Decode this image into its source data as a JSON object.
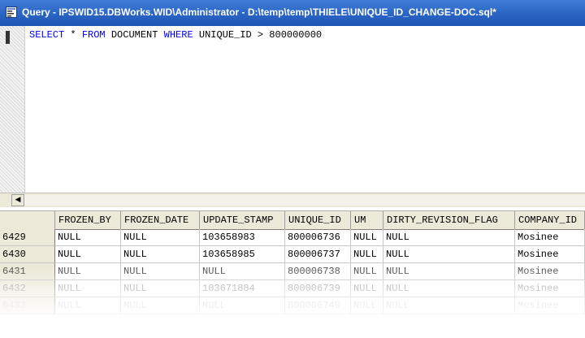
{
  "window": {
    "title": "Query - IPSWID15.DBWorks.WID\\Administrator - D:\\temp\\temp\\THIELE\\UNIQUE_ID_CHANGE-DOC.sql*"
  },
  "editor": {
    "sql_kw_select": "SELECT",
    "sql_star": " * ",
    "sql_kw_from": "FROM",
    "sql_table": " DOCUMENT ",
    "sql_kw_where": "WHERE",
    "sql_condition": " UNIQUE_ID > 800000000"
  },
  "grid": {
    "columns": [
      "FROZEN_BY",
      "FROZEN_DATE",
      "UPDATE_STAMP",
      "UNIQUE_ID",
      "UM",
      "DIRTY_REVISION_FLAG",
      "COMPANY_ID"
    ],
    "rows": [
      {
        "num": "6429",
        "cells": [
          "NULL",
          "NULL",
          "103658983",
          "800006736",
          "NULL",
          "NULL",
          "Mosinee"
        ]
      },
      {
        "num": "6430",
        "cells": [
          "NULL",
          "NULL",
          "103658985",
          "800006737",
          "NULL",
          "NULL",
          "Mosinee"
        ]
      },
      {
        "num": "6431",
        "cells": [
          "NULL",
          "NULL",
          "NULL",
          "800006738",
          "NULL",
          "NULL",
          "Mosinee"
        ]
      },
      {
        "num": "6432",
        "cells": [
          "NULL",
          "NULL",
          "103671884",
          "800006739",
          "NULL",
          "NULL",
          "Mosinee"
        ]
      },
      {
        "num": "6433",
        "cells": [
          "NULL",
          "NULL",
          "NULL",
          "800006740",
          "NULL",
          "NULL",
          "Mosinee"
        ]
      }
    ]
  },
  "colors": {
    "keyword": "#0000ff",
    "titlebar": "#2a64c4"
  }
}
